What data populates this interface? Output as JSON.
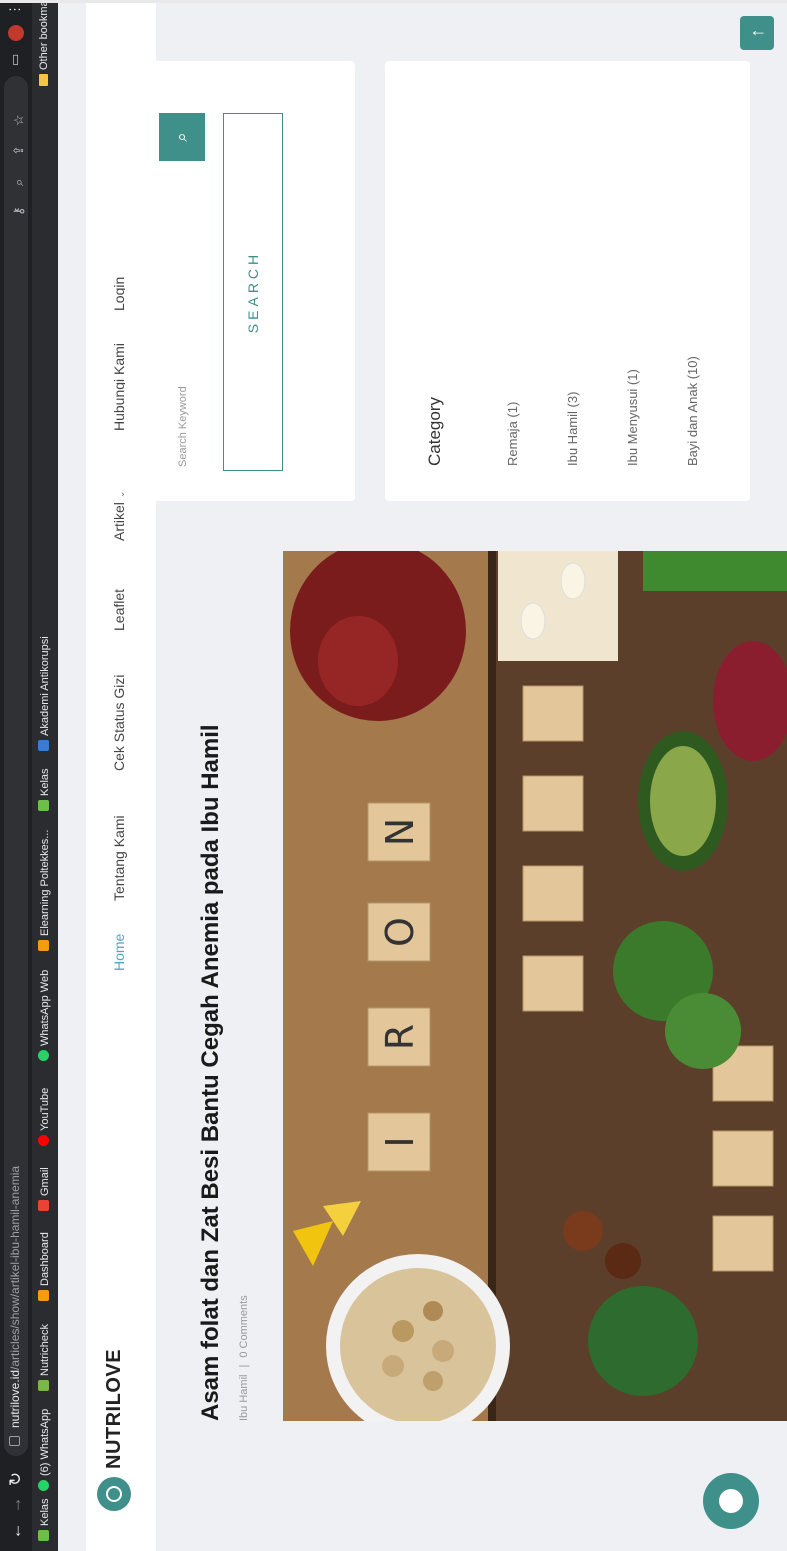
{
  "browser": {
    "url_host": "nutrilove.id",
    "url_path": "/articles/show/artikel-ibu-hamil-anemia",
    "bookmarks": [
      "Kelas",
      "(6) WhatsApp",
      "Nutricheck",
      "Dashboard",
      "Gmail",
      "YouTube",
      "WhatsApp Web",
      "Elearning Poltekkes...",
      "Kelas",
      "Akademi Antikorupsi"
    ],
    "other_bookmarks": "Other bookmarks"
  },
  "site": {
    "brand": "NUTRILOVE",
    "nav": [
      "Home",
      "Tentang Kami",
      "Cek Status Gizi",
      "Leaflet",
      "Artikel",
      "Hubungi Kami",
      "Login"
    ]
  },
  "article": {
    "title": "Asam folat dan Zat Besi Bantu Cegah Anemia pada Ibu Hamil",
    "category": "Ibu Hamil",
    "separator": "|",
    "comments": "0 Comments"
  },
  "sidebar": {
    "search_placeholder": "Search Keyword",
    "search_button": "SEARCH",
    "category_title": "Category",
    "categories": [
      "Remaja (1)",
      "Ibu Hamil (3)",
      "Ibu Menyusui (1)",
      "Bayi dan Anak (10)"
    ]
  },
  "colors": {
    "accent": "#3f8f8b",
    "nav_active": "#52a3c8"
  }
}
